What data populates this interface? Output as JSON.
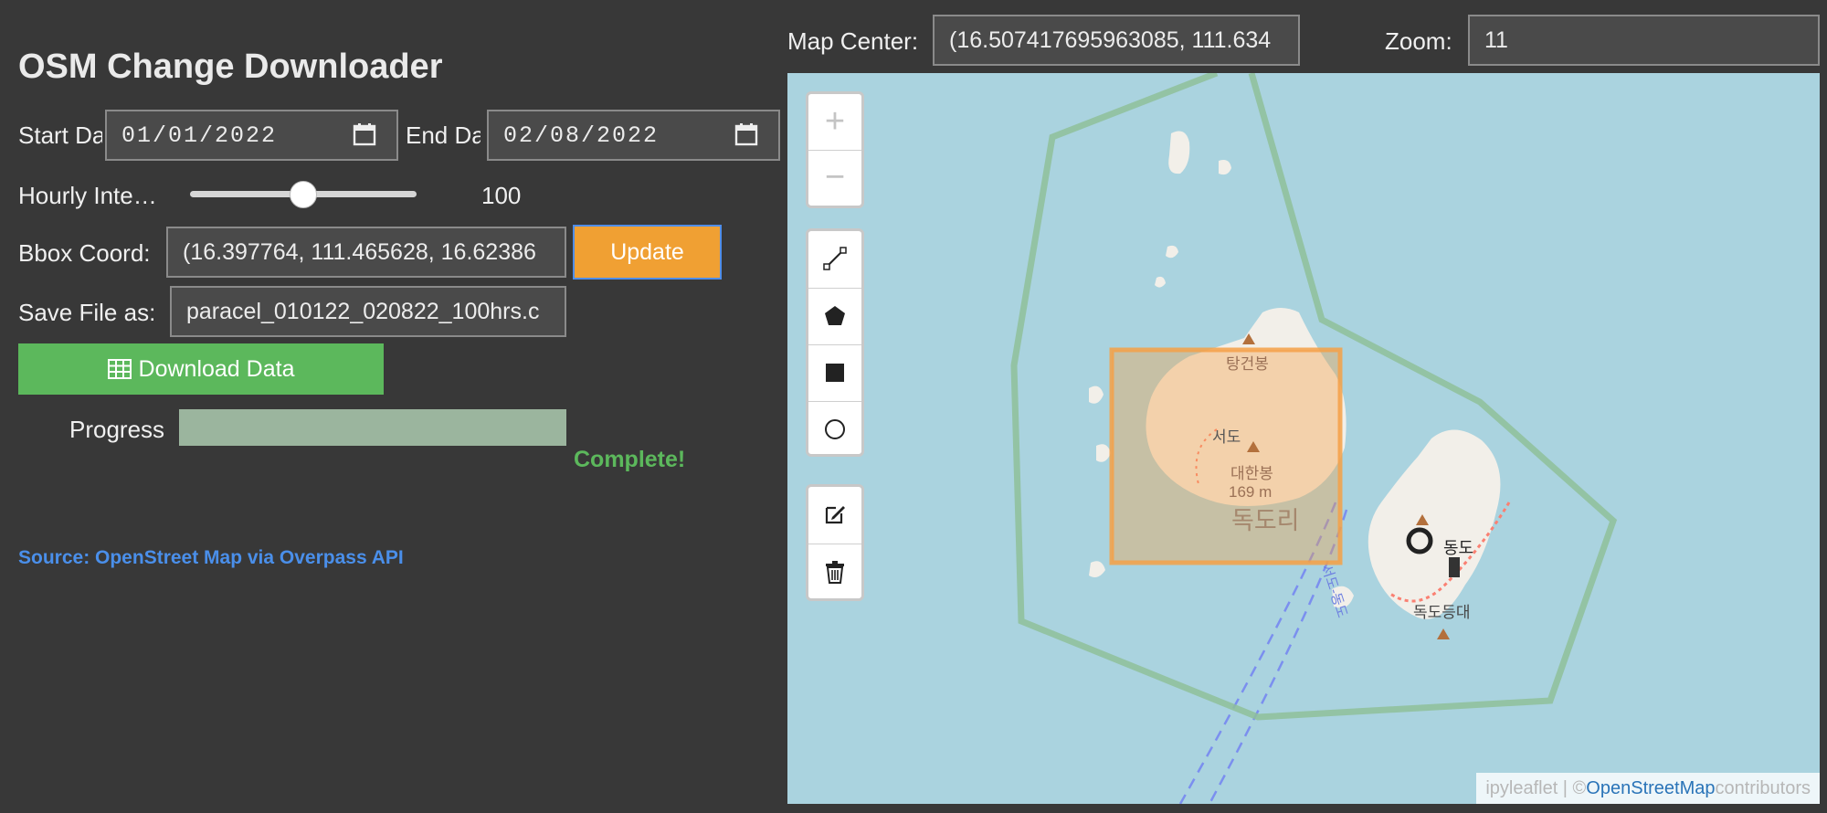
{
  "app_title": "OSM Change Downloader",
  "start_date": {
    "label": "Start Da",
    "value": "01/01/2022",
    "icon": "calendar-icon"
  },
  "end_date": {
    "label": "End Da",
    "value": "02/08/2022",
    "icon": "calendar-icon"
  },
  "hourly_interval": {
    "label": "Hourly Inte…",
    "value": "100",
    "fraction": 0.5
  },
  "bbox": {
    "label": "Bbox Coord:",
    "value": "(16.397764, 111.465628, 16.62386"
  },
  "update_button": {
    "label": "Update",
    "color": "#f0a033"
  },
  "save_file": {
    "label": "Save File as:",
    "value": "paracel_010122_020822_100hrs.c"
  },
  "download_button": {
    "label": "Download Data",
    "icon": "table-icon",
    "color": "#5cb85c"
  },
  "progress": {
    "label": "Progress",
    "value": 1.0,
    "status": "Complete!",
    "status_color": "#5cb85c"
  },
  "source_text": "Source: OpenStreet Map via Overpass API",
  "map_center": {
    "label": "Map Center:",
    "value": "(16.507417695963085, 111.634"
  },
  "zoom": {
    "label": "Zoom:",
    "value": "11"
  },
  "map": {
    "zoom_in": "+",
    "zoom_out": "−",
    "draw_tools": [
      "polyline-icon",
      "polygon-icon",
      "rectangle-icon",
      "circle-icon"
    ],
    "edit_tools": [
      "edit-icon",
      "trash-icon"
    ],
    "labels": {
      "peak1": "탕건봉",
      "west_island": "서도",
      "peak2": "대한봉",
      "elevation": "169 m",
      "village": "독도리",
      "east_island": "동도",
      "lighthouse": "독도등대",
      "route": "서도-동도"
    },
    "attribution_prefix": "ipyleaflet | © ",
    "attribution_link": "OpenStreetMap",
    "attribution_suffix": " contributors"
  }
}
